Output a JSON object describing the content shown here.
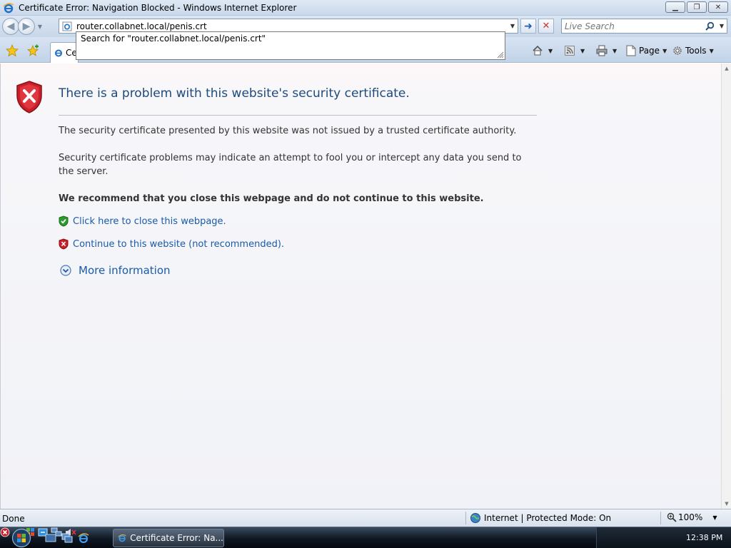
{
  "window": {
    "title": "Certificate Error: Navigation Blocked - Windows Internet Explorer",
    "minimize_icon": "minimize-icon",
    "maximize_icon": "restore-icon",
    "close_icon": "close-icon"
  },
  "nav": {
    "address": "router.collabnet.local/penis.crt",
    "search_placeholder": "Live Search",
    "autocomplete": "Search for \"router.collabnet.local/penis.crt\""
  },
  "tab": {
    "label": "Ce"
  },
  "commands": {
    "page": "Page",
    "tools": "Tools"
  },
  "content": {
    "title": "There is a problem with this website's security certificate.",
    "para1": "The security certificate presented by this website was not issued by a trusted certificate authority.",
    "para2": "Security certificate problems may indicate an attempt to fool you or intercept any data you send to the server.",
    "recommend": "We recommend that you close this webpage and do not continue to this website.",
    "close_link": "Click here to close this webpage.",
    "continue_link": "Continue to this website (not recommended).",
    "more_info": "More information"
  },
  "status": {
    "text": "Done",
    "zone": "Internet | Protected Mode: On",
    "zoom": "100%"
  },
  "taskbar": {
    "task_label": "Certificate Error: Na...",
    "clock": "12:38 PM"
  },
  "colors": {
    "link": "#1a5aa8",
    "title": "#1f4a7c",
    "error_red": "#c8202a",
    "safe_green": "#2e9a2e"
  }
}
